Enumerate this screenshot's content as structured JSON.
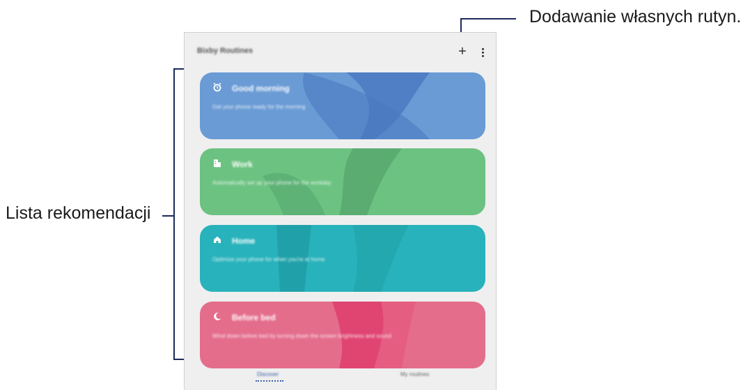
{
  "app": {
    "title": "Bixby Routines",
    "add_icon": "plus-icon",
    "menu_icon": "more-vertical-icon"
  },
  "cards": [
    {
      "title": "Good morning",
      "desc": "Get your phone ready for the morning",
      "icon": "alarm-icon",
      "color": "#6a9bd5"
    },
    {
      "title": "Work",
      "desc": "Automatically set up your phone for the workday",
      "icon": "building-icon",
      "color": "#6cc281"
    },
    {
      "title": "Home",
      "desc": "Optimize your phone for when you're at home",
      "icon": "home-icon",
      "color": "#28b2bb"
    },
    {
      "title": "Before bed",
      "desc": "Wind down before bed by turning down the screen brightness and sound",
      "icon": "moon-icon",
      "color": "#e46d8c"
    }
  ],
  "tabs": {
    "discover": "Discover",
    "my_routines": "My routines"
  },
  "annotations": {
    "add_routines": "Dodawanie własnych rutyn.",
    "recommendations": "Lista rekomendacji"
  },
  "colors": {
    "accent": "#3a5fa8",
    "annotation_line": "#1a2a5a"
  }
}
